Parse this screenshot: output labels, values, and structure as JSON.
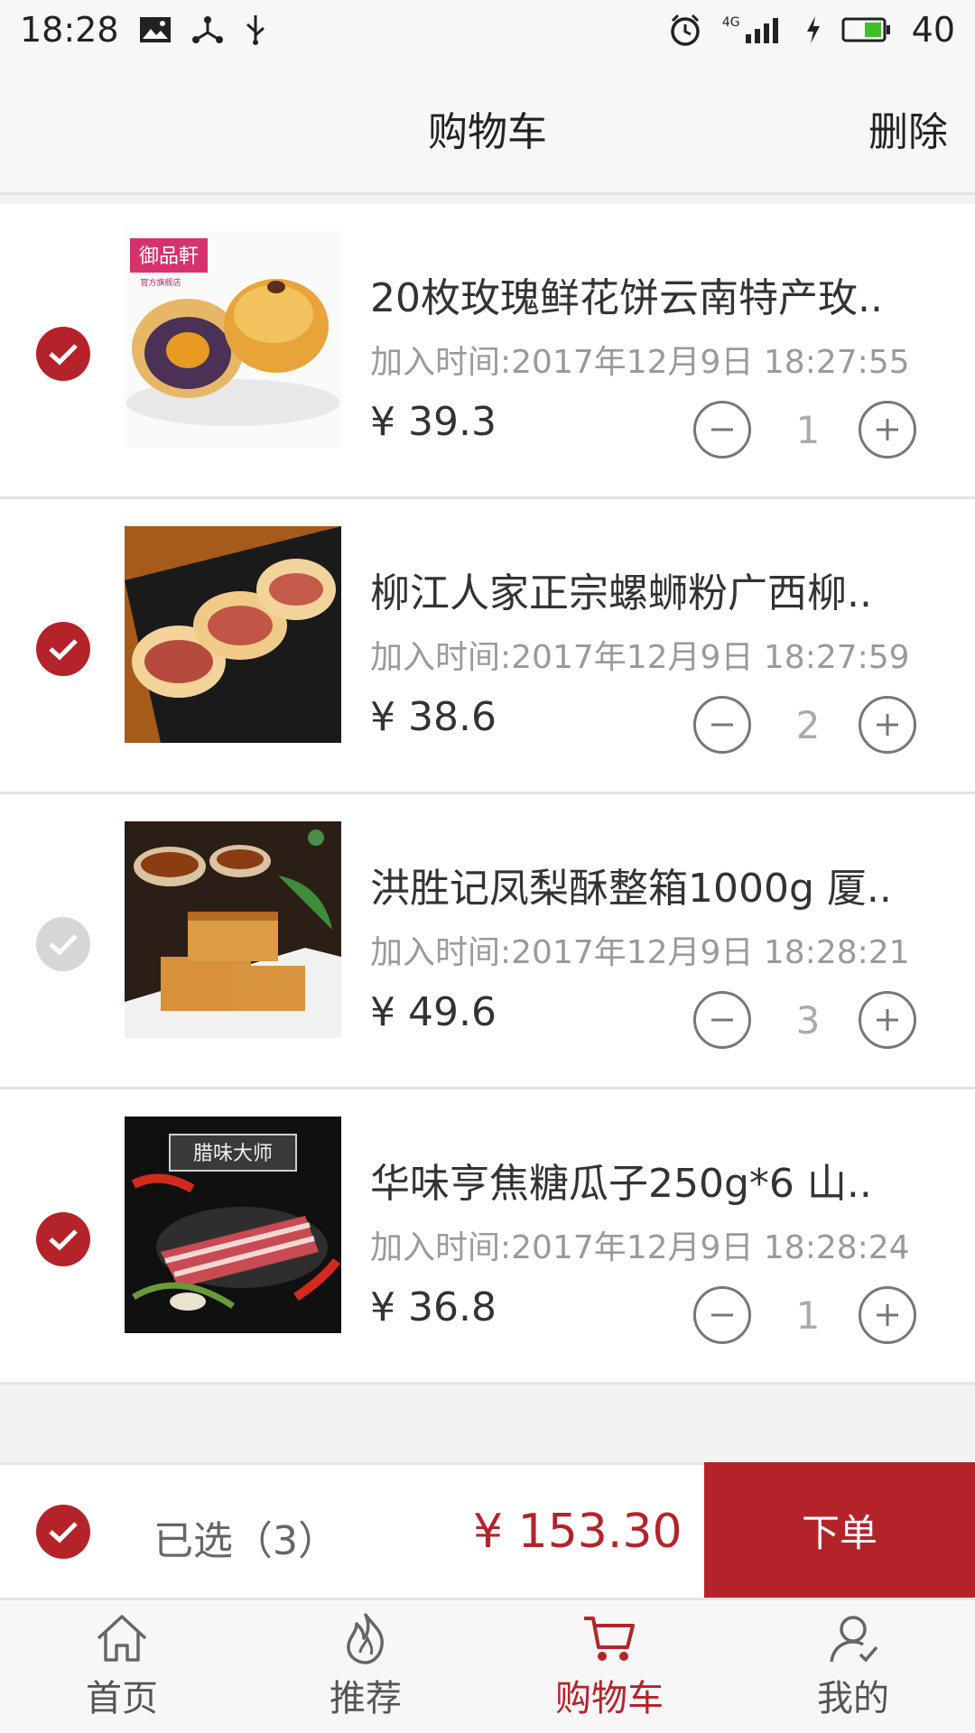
{
  "status_bar": {
    "time": "18:28",
    "battery": "40",
    "network": "4G"
  },
  "header": {
    "title": "购物车",
    "delete_label": "删除"
  },
  "cart": {
    "items": [
      {
        "name": "20枚玫瑰鲜花饼云南特产玫..",
        "added": "加入时间:2017年12月9日 18:27:55",
        "price": "¥ 39.3",
        "qty": "1",
        "checked": true
      },
      {
        "name": "柳江人家正宗螺蛳粉广西柳..",
        "added": "加入时间:2017年12月9日 18:27:59",
        "price": "¥ 38.6",
        "qty": "2",
        "checked": true
      },
      {
        "name": "洪胜记凤梨酥整箱1000g 厦..",
        "added": "加入时间:2017年12月9日 18:28:21",
        "price": "¥ 49.6",
        "qty": "3",
        "checked": false
      },
      {
        "name": "华味亨焦糖瓜子250g*6 山..",
        "added": "加入时间:2017年12月9日 18:28:24",
        "price": "¥ 36.8",
        "qty": "1",
        "checked": true
      }
    ],
    "thumb_text": {
      "brand": "御品軒",
      "shop": "官方旗舰店",
      "tag": "腊味大师"
    }
  },
  "footer": {
    "selected": "已选（3）",
    "total": "¥ 153.30",
    "order_label": "下单"
  },
  "tabs": [
    {
      "label": "首页",
      "icon": "home-icon"
    },
    {
      "label": "推荐",
      "icon": "flame-icon"
    },
    {
      "label": "购物车",
      "icon": "cart-icon"
    },
    {
      "label": "我的",
      "icon": "user-icon"
    }
  ],
  "colors": {
    "accent": "#b5232a",
    "muted_check": "#d6d6d6",
    "text": "#333333",
    "time_text": "#9a9a9a"
  }
}
